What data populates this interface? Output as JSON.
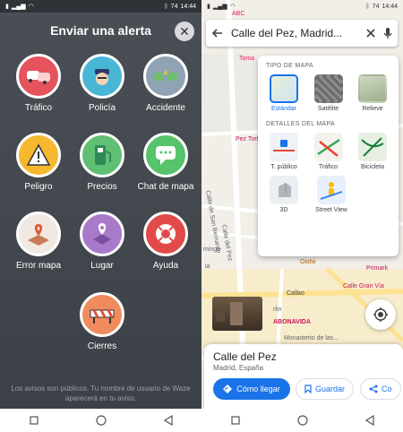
{
  "left": {
    "status": {
      "time": "14:44",
      "battery": "74"
    },
    "title": "Enviar una alerta",
    "alerts": [
      {
        "label": "Tráfico",
        "icon": "traffic-icon",
        "color": "#e5535d"
      },
      {
        "label": "Policía",
        "icon": "police-icon",
        "color": "#49b6d6"
      },
      {
        "label": "Accidente",
        "icon": "accident-icon",
        "color": "#8fa3b5"
      },
      {
        "label": "Peligro",
        "icon": "hazard-icon",
        "color": "#f5b82e"
      },
      {
        "label": "Precios",
        "icon": "gas-price-icon",
        "color": "#5fbf73"
      },
      {
        "label": "Chat de mapa",
        "icon": "map-chat-icon",
        "color": "#57c36a"
      },
      {
        "label": "Error mapa",
        "icon": "map-error-icon",
        "color": "#efe9e2"
      },
      {
        "label": "Lugar",
        "icon": "place-icon",
        "color": "#a97ac9"
      },
      {
        "label": "Ayuda",
        "icon": "help-icon",
        "color": "#e24a4a"
      },
      {
        "label": "Cierres",
        "icon": "closure-icon",
        "color": "#f08b5e"
      }
    ],
    "footnote": "Los avisos son públicos. Tu nombre de usuario de Waze aparecerá en tu aviso."
  },
  "right": {
    "status": {
      "time": "14:44",
      "battery": "74"
    },
    "search": {
      "value": "Calle del Pez, Madrid..."
    },
    "map_type": {
      "heading": "TIPO DE MAPA",
      "options": [
        {
          "label": "Estándar",
          "selected": true
        },
        {
          "label": "Satélite",
          "selected": false
        },
        {
          "label": "Relieve",
          "selected": false
        }
      ]
    },
    "map_details": {
      "heading": "DETALLES DEL MAPA",
      "options": [
        {
          "label": "T. público"
        },
        {
          "label": "Tráfico"
        },
        {
          "label": "Bicicleta"
        },
        {
          "label": "3D"
        },
        {
          "label": "Street View"
        }
      ]
    },
    "map_labels": {
      "abc": "ABC",
      "toma": "Toma",
      "pez": "Pez Tortilla",
      "san_bernardo": "Calle de San Bernardo",
      "pez_street": "Calle del Pez",
      "oishii": "Oishii",
      "primark": "Primark",
      "gran_via": "Calle Gran Vía",
      "callao": "Callao",
      "abonavida": "ABONAVIDA",
      "monasterio": "Monasterio de las...",
      "mingo": "mingo",
      "ia": "ia",
      "rlin": "rlin",
      "il": "Il"
    },
    "place": {
      "name": "Calle del Pez",
      "subtitle": "Madrid, España",
      "directions_label": "Cómo llegar",
      "save_label": "Guardar",
      "share_label": "Co"
    }
  }
}
